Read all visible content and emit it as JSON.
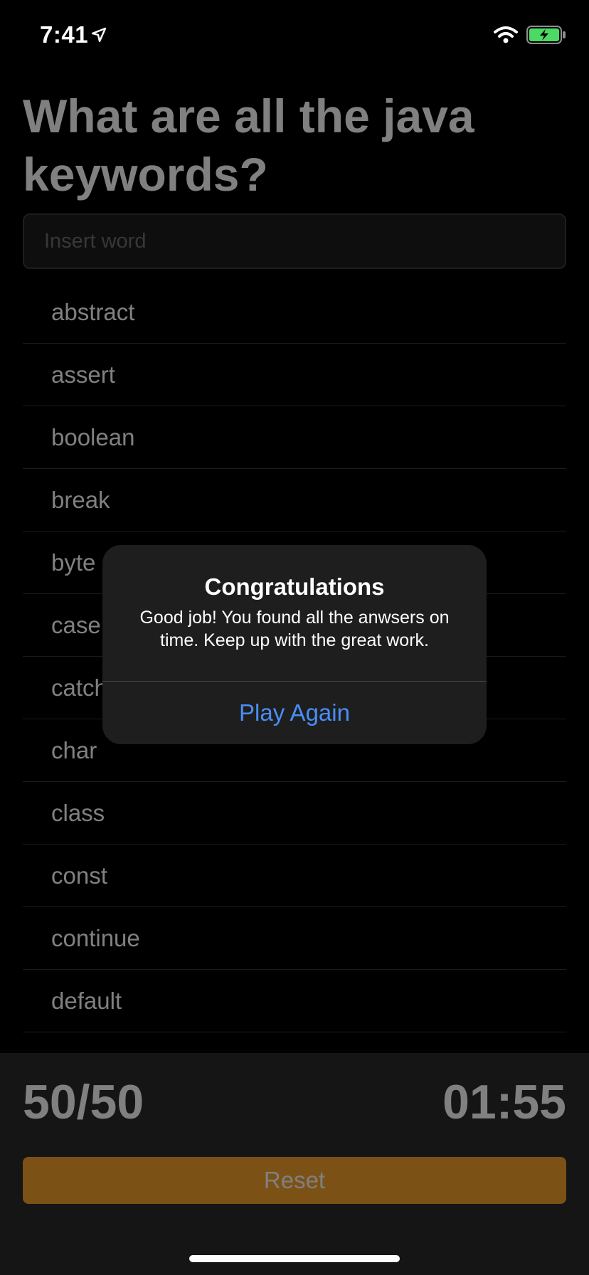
{
  "status_bar": {
    "time": "7:41",
    "location_icon": "location-arrow-icon",
    "wifi_icon": "wifi-icon",
    "battery_icon": "battery-charging-icon",
    "battery_color": "#4cd964"
  },
  "quiz": {
    "title": "What are all the java keywords?",
    "input_placeholder": "Insert word",
    "input_value": ""
  },
  "answers": [
    "abstract",
    "assert",
    "boolean",
    "break",
    "byte",
    "case",
    "catch",
    "char",
    "class",
    "const",
    "continue",
    "default"
  ],
  "footer": {
    "score": "50/50",
    "timer": "01:55",
    "reset_label": "Reset",
    "reset_color": "#f6a22b"
  },
  "alert": {
    "title": "Congratulations",
    "message": "Good job! You found all the anwsers on time. Keep up with the great work.",
    "button_label": "Play Again",
    "button_color": "#4a8df6"
  }
}
